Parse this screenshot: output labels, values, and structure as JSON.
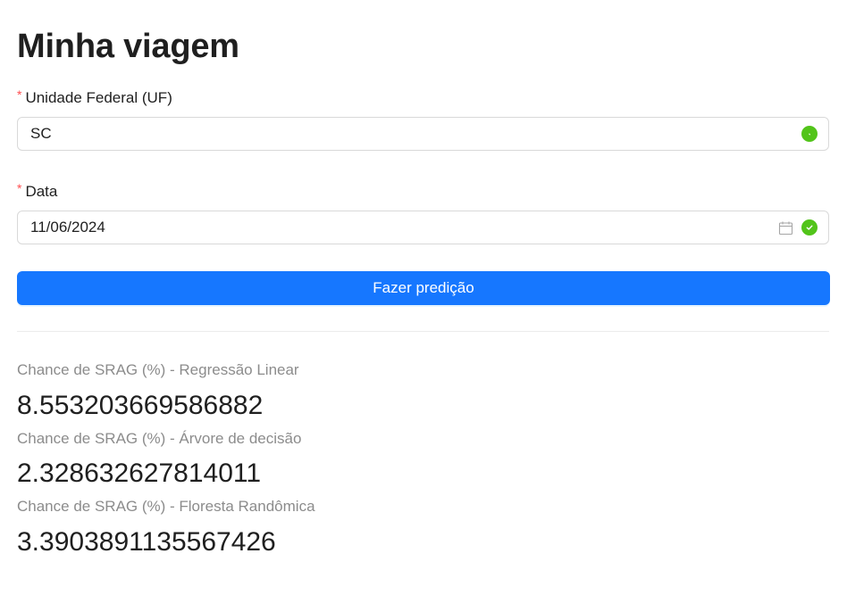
{
  "page": {
    "title": "Minha viagem"
  },
  "form": {
    "uf": {
      "required_mark": "*",
      "label": "Unidade Federal (UF)",
      "value": "SC",
      "status": "success"
    },
    "date": {
      "required_mark": "*",
      "label": "Data",
      "value": "11/06/2024",
      "status": "success"
    },
    "submit_label": "Fazer predição"
  },
  "results": [
    {
      "title": "Chance de SRAG (%) - Regressão Linear",
      "value": "8.553203669586882"
    },
    {
      "title": "Chance de SRAG (%) - Árvore de decisão",
      "value": "2.328632627814011"
    },
    {
      "title": "Chance de SRAG (%) - Floresta Randômica",
      "value": "3.3903891135567426"
    }
  ],
  "colors": {
    "primary": "#1677ff",
    "success": "#52c41a",
    "required": "#ff4d4f",
    "muted_text": "#8c8c8c"
  }
}
